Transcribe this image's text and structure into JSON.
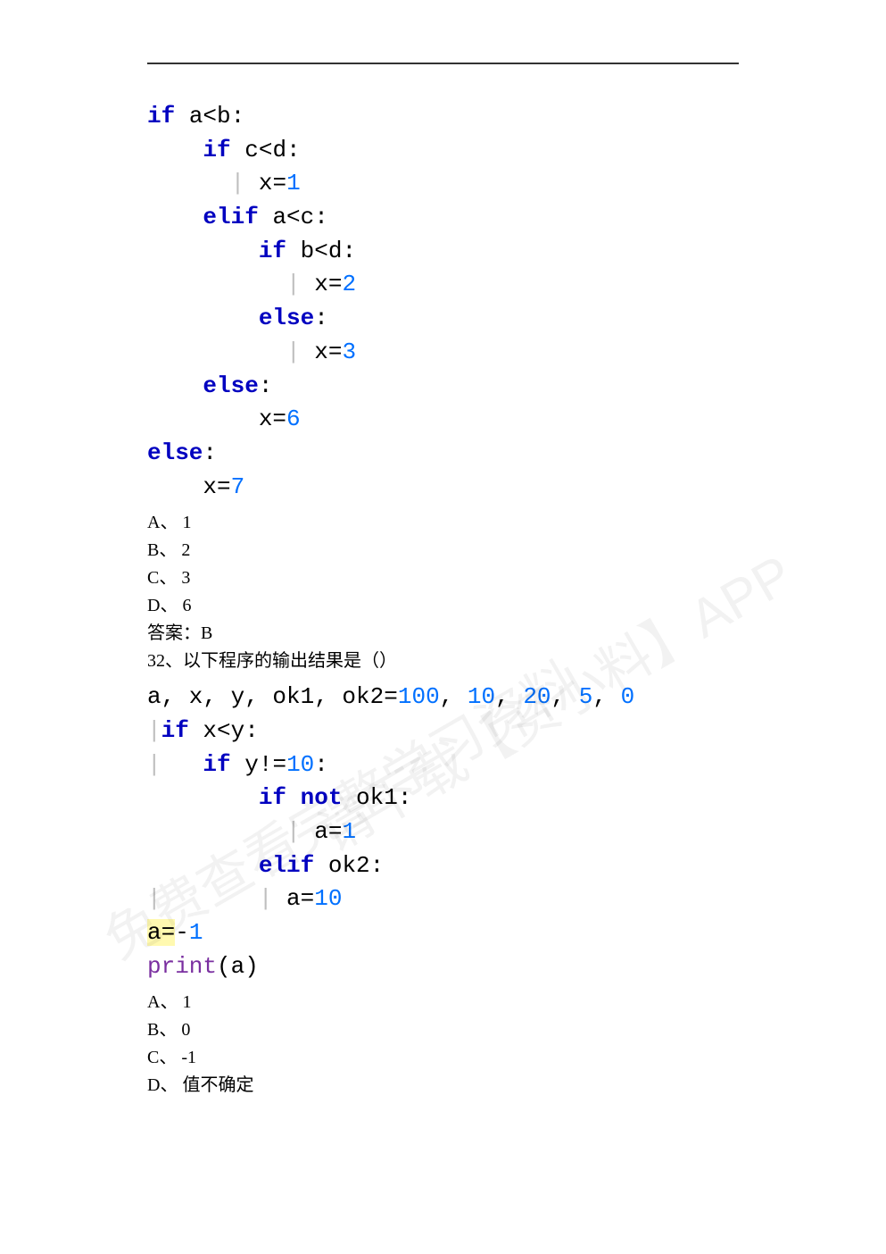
{
  "q31": {
    "code": {
      "l1": {
        "kw": "if",
        "rest": " a<b:"
      },
      "l2": {
        "kw": "if",
        "rest": " c<d:"
      },
      "l3": {
        "lhs": "x=",
        "num": "1"
      },
      "l4": {
        "kw": "elif",
        "rest": " a<c:"
      },
      "l5": {
        "kw": "if",
        "rest": " b<d:"
      },
      "l6": {
        "lhs": "x=",
        "num": "2"
      },
      "l7": {
        "kw": "else",
        "rest": ":"
      },
      "l8": {
        "lhs": "x=",
        "num": "3"
      },
      "l9": {
        "kw": "else",
        "rest": ":"
      },
      "l10": {
        "lhs": "x=",
        "num": "6"
      },
      "l11": {
        "kw": "else",
        "rest": ":"
      },
      "l12": {
        "lhs": "x=",
        "num": "7"
      }
    },
    "options": {
      "a": "A、 1",
      "b": "B、 2",
      "c": "C、 3",
      "d": "D、 6"
    },
    "answer": "答案：B"
  },
  "q32": {
    "prompt": "32、以下程序的输出结果是（）",
    "code": {
      "l1": {
        "lhs": "a, x, y, ok1, ok2=",
        "nums": [
          "100",
          "10",
          "20",
          "5",
          "0"
        ]
      },
      "l2": {
        "kw": "if",
        "rest": " x<y:"
      },
      "l3": {
        "kw": "if",
        "rest": " y!=",
        "num": "10",
        "tail": ":"
      },
      "l4": {
        "kw": "if not",
        "rest": " ok1:"
      },
      "l5": {
        "lhs": "a=",
        "num": "1"
      },
      "l6": {
        "kw": "elif",
        "rest": " ok2:"
      },
      "l7": {
        "lhs": "a=",
        "num": "10"
      },
      "l8": {
        "hl": "a=",
        "rest": "-",
        "num": "1"
      },
      "l9": {
        "fn": "print",
        "rest": "(a)"
      }
    },
    "options": {
      "a": "A、 1",
      "b": "B、 0",
      "c": "C、 -1",
      "d": "D、 值不确定"
    }
  },
  "watermark": {
    "t1": "免费查看完整学习资料",
    "t2": "请下载【资小料】APP"
  }
}
